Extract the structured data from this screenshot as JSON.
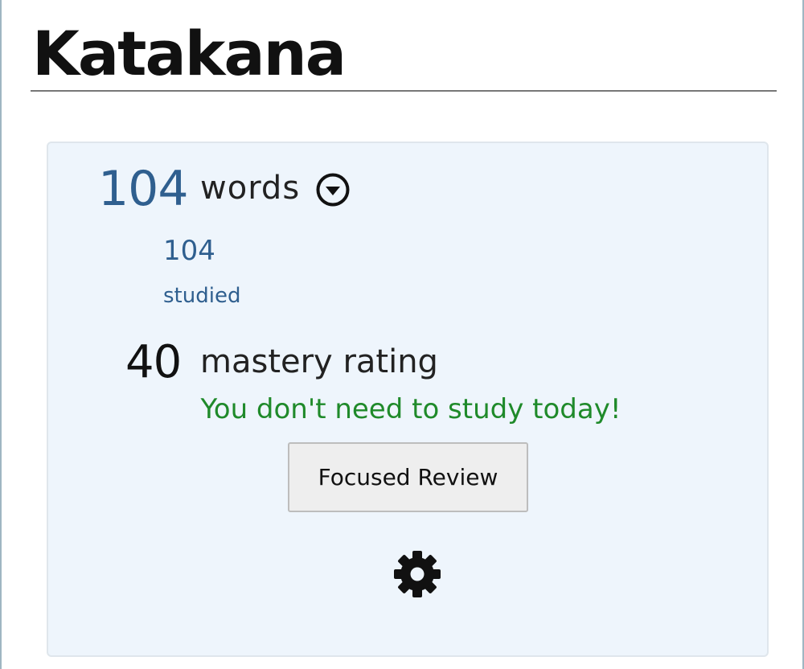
{
  "page": {
    "title": "Katakana"
  },
  "card": {
    "words_count": "104",
    "words_label": "words",
    "studied_count": "104",
    "studied_label": "studied",
    "mastery_value": "40",
    "mastery_label": "mastery rating",
    "study_message": "You don't need to study today!",
    "review_button_label": "Focused Review",
    "icons": {
      "expand": "chevron-down-circle-icon",
      "settings": "gear-icon"
    }
  },
  "colors": {
    "count_blue": "#2f5f8f",
    "message_green": "#1f8a2a",
    "card_background": "#eef5fc"
  }
}
